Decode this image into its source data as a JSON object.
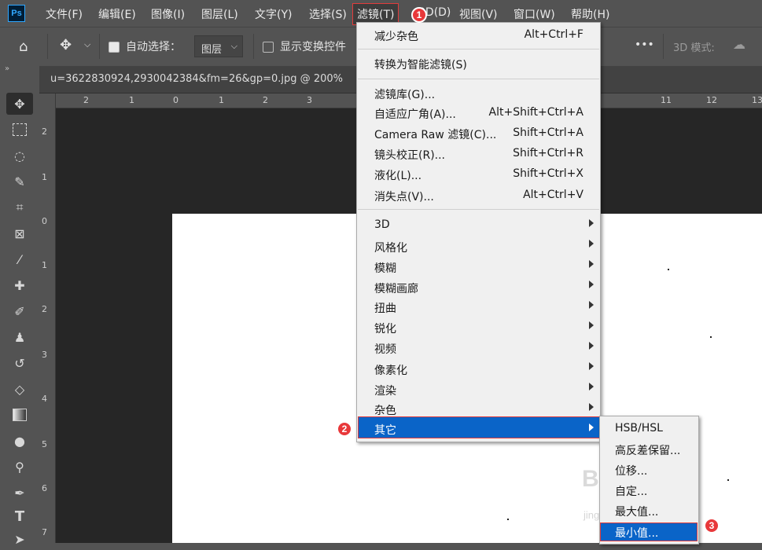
{
  "app": {
    "logo": "Ps"
  },
  "menubar": {
    "items": [
      "文件(F)",
      "编辑(E)",
      "图像(I)",
      "图层(L)",
      "文字(Y)",
      "选择(S)",
      "滤镜(T)",
      "3D(D)",
      "视图(V)",
      "窗口(W)",
      "帮助(H)"
    ],
    "active_index": 6
  },
  "options": {
    "auto_select_label": "自动选择：",
    "auto_select_checked": true,
    "layer_select": "图层",
    "show_transform_label": "显示变换控件",
    "more_label": "•••",
    "mode_3d_label": "3D 模式:"
  },
  "document": {
    "tab_title": "u=3622830924,2930042384&fm=26&gp=0.jpg  @  200%"
  },
  "ruler": {
    "h_ticks": [
      "2",
      "1",
      "0",
      "1",
      "2",
      "3",
      "11",
      "12",
      "13"
    ],
    "v_ticks": [
      "2",
      "1",
      "0",
      "1",
      "2",
      "3",
      "4",
      "5",
      "6",
      "7"
    ]
  },
  "filter_menu": {
    "groups": [
      [
        {
          "label": "减少杂色",
          "shortcut": "Alt+Ctrl+F"
        }
      ],
      [
        {
          "label": "转换为智能滤镜(S)",
          "shortcut": ""
        }
      ],
      [
        {
          "label": "滤镜库(G)...",
          "shortcut": ""
        },
        {
          "label": "自适应广角(A)...",
          "shortcut": "Alt+Shift+Ctrl+A"
        },
        {
          "label": "Camera Raw 滤镜(C)...",
          "shortcut": "Shift+Ctrl+A"
        },
        {
          "label": "镜头校正(R)...",
          "shortcut": "Shift+Ctrl+R"
        },
        {
          "label": "液化(L)...",
          "shortcut": "Shift+Ctrl+X"
        },
        {
          "label": "消失点(V)...",
          "shortcut": "Alt+Ctrl+V"
        }
      ],
      [
        {
          "label": "3D"
        },
        {
          "label": "风格化"
        },
        {
          "label": "模糊"
        },
        {
          "label": "模糊画廊"
        },
        {
          "label": "扭曲"
        },
        {
          "label": "锐化"
        },
        {
          "label": "视频"
        },
        {
          "label": "像素化"
        },
        {
          "label": "渲染"
        },
        {
          "label": "杂色"
        },
        {
          "label": "其它"
        }
      ]
    ],
    "highlighted": "其它"
  },
  "other_submenu": {
    "items": [
      "HSB/HSL",
      "高反差保留...",
      "位移...",
      "自定...",
      "最大值...",
      "最小值..."
    ],
    "highlighted": "最小值..."
  },
  "badges": [
    "1",
    "2",
    "3"
  ],
  "watermark": {
    "text": "Bai 经验",
    "sub": "jingyan.baidu.com"
  },
  "colors": {
    "highlight": "#0a64c8",
    "badge": "#e8383a",
    "ui_bg": "#535353",
    "canvas_bg": "#262626"
  }
}
